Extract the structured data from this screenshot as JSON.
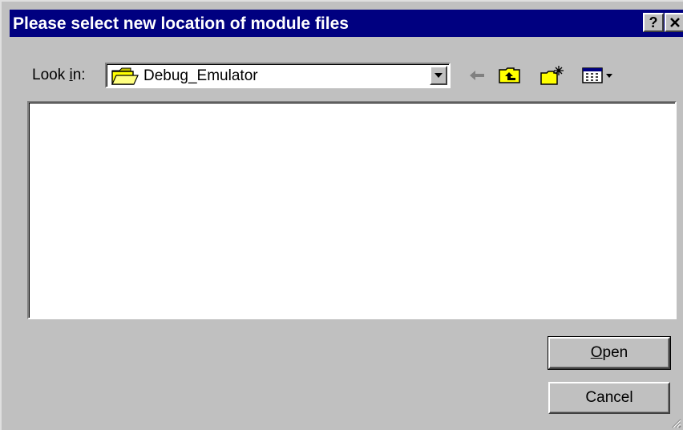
{
  "window": {
    "title": "Please select new location of module files",
    "help_label": "?",
    "close_label": "✕"
  },
  "toolbar": {
    "look_in_prefix": "Look ",
    "look_in_mnemonic": "i",
    "look_in_suffix": "n:",
    "current_folder": "Debug_Emulator",
    "icons": [
      "folder-icon",
      "dropdown-arrow-icon",
      "back-arrow-icon",
      "up-one-level-icon",
      "new-folder-icon",
      "view-menu-icon"
    ]
  },
  "file_list": {
    "items": []
  },
  "buttons": {
    "open_mnemonic": "O",
    "open_rest": "pen",
    "cancel": "Cancel"
  },
  "colors": {
    "titlebar": "#000080",
    "face": "#c0c0c0",
    "folder": "#ffff00"
  }
}
